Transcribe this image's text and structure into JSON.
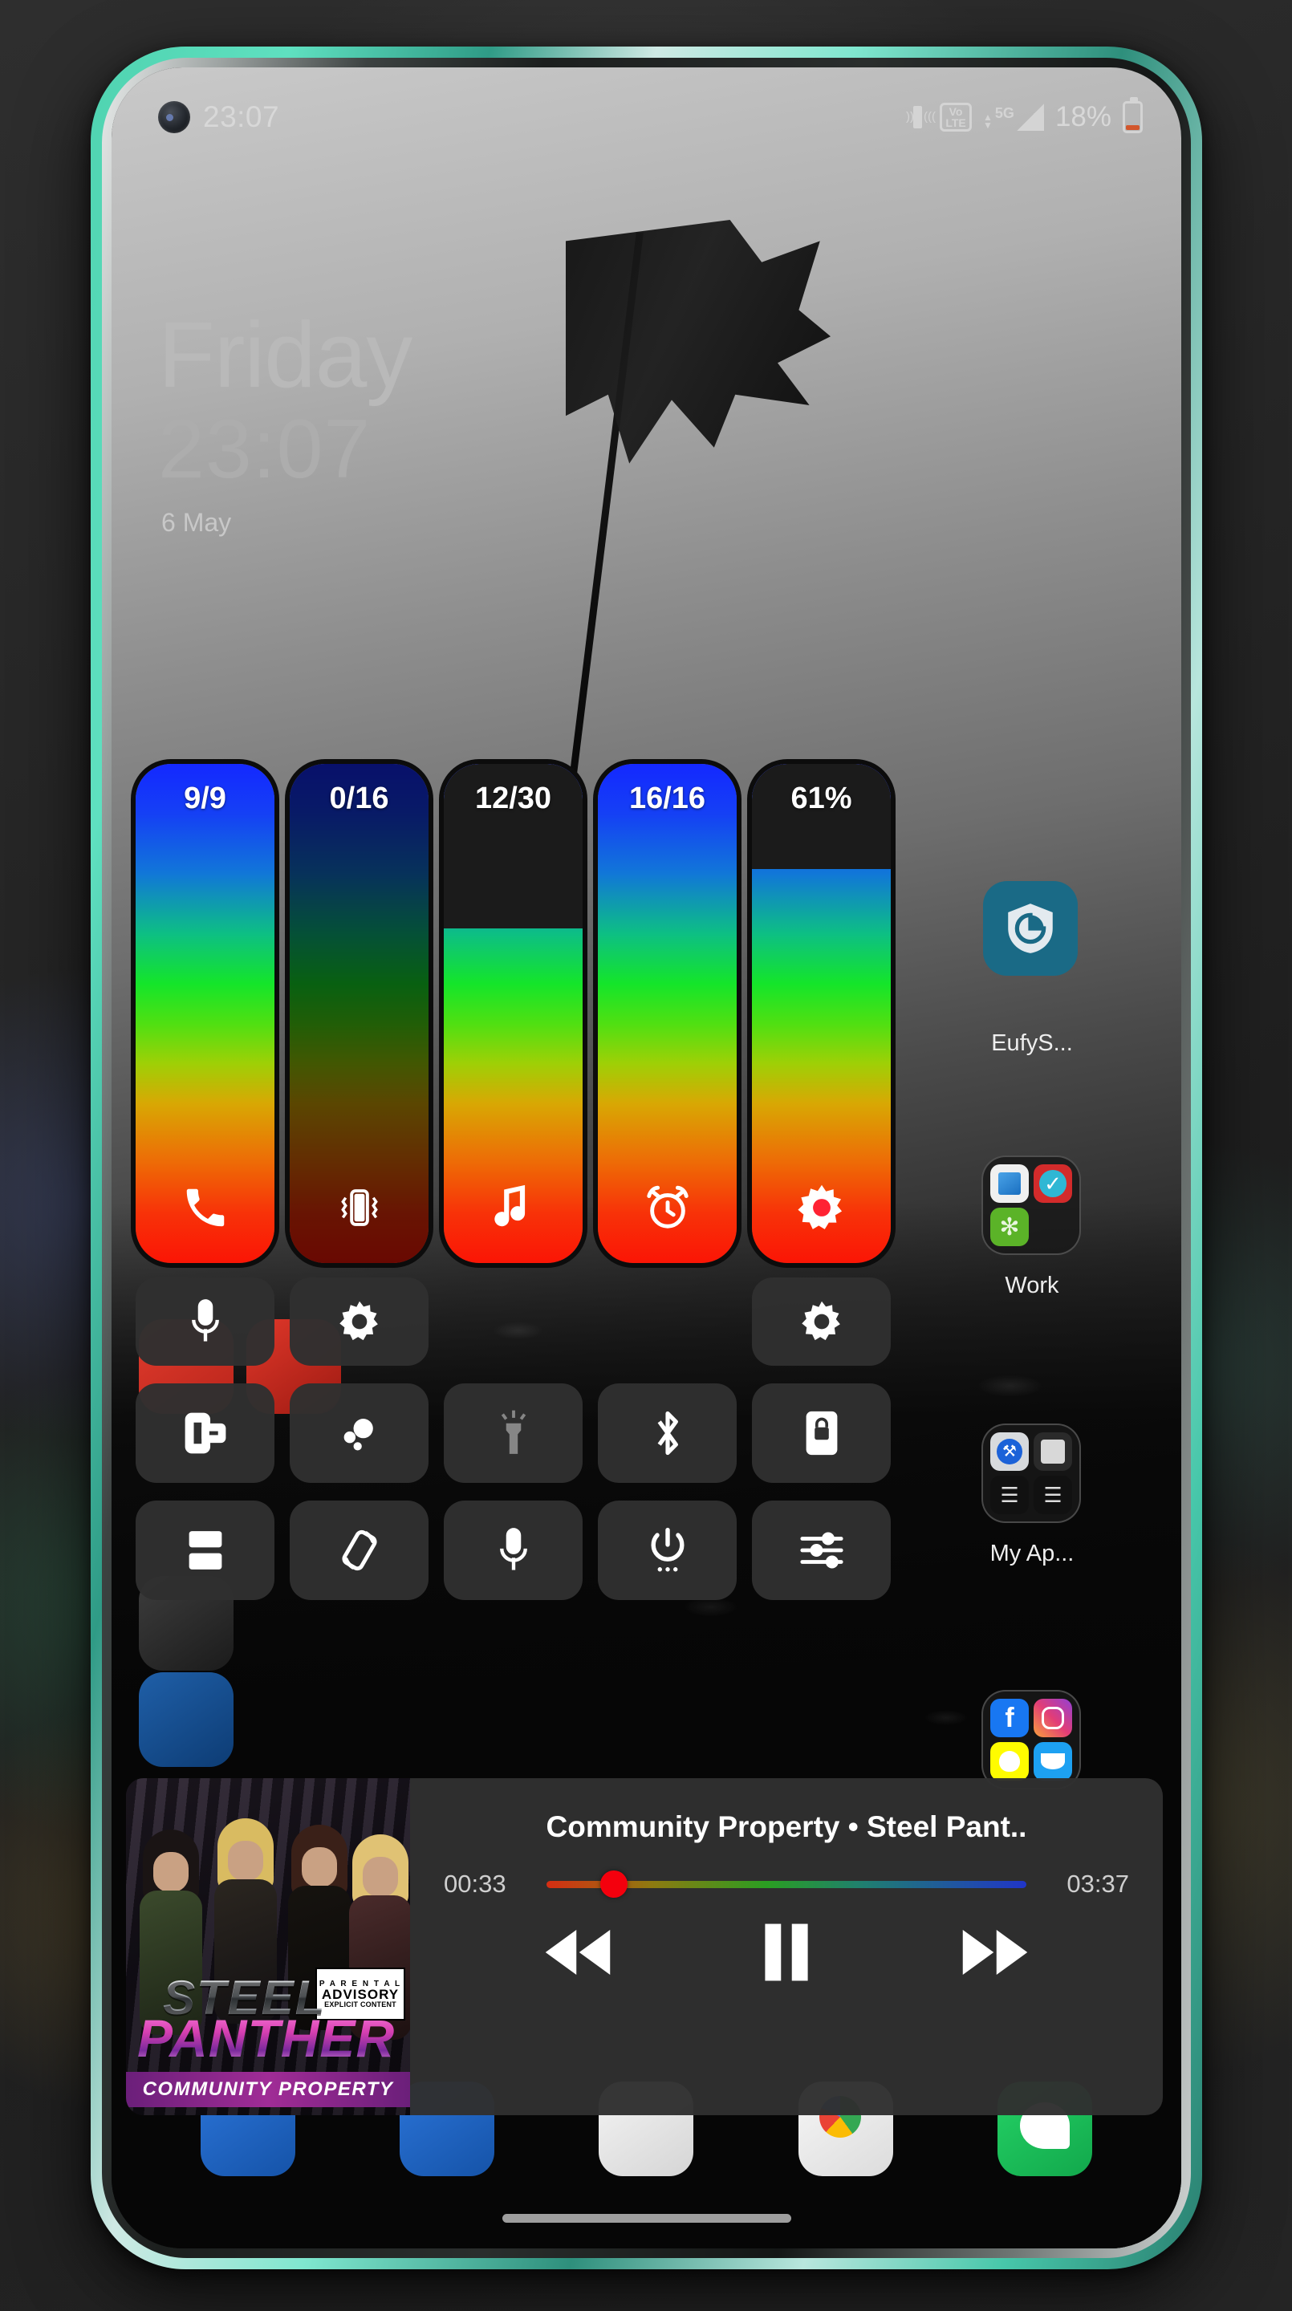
{
  "device": {
    "frame_color": "#4fd3b0",
    "earpiece": "speaker-grille"
  },
  "status_bar": {
    "clock": "23:07",
    "battery_percent": "18%",
    "network_type": "5G",
    "volte_line1": "Vo",
    "volte_line2": "LTE",
    "icons": [
      "camera-punch-hole",
      "vibrate-icon",
      "volte-icon",
      "data-arrows-icon",
      "signal-bars-icon",
      "battery-icon"
    ]
  },
  "lockscreen_widget": {
    "day": "Friday",
    "time": "23:07",
    "date": "6 May"
  },
  "volume_panel": {
    "sliders": [
      {
        "name": "ring",
        "value_label": "9/9",
        "icon": "phone-icon",
        "level_pct": 100,
        "dim": false
      },
      {
        "name": "notification",
        "value_label": "0/16",
        "icon": "vibrate-icon",
        "level_pct": 100,
        "dim": true
      },
      {
        "name": "media",
        "value_label": "12/30",
        "icon": "music-note-icon",
        "level_pct": 67,
        "dim": false
      },
      {
        "name": "alarm",
        "value_label": "16/16",
        "icon": "alarm-clock-icon",
        "level_pct": 100,
        "dim": false
      },
      {
        "name": "brightness",
        "value_label": "61%",
        "icon": "brightness-icon",
        "level_pct": 79,
        "dim": false
      }
    ],
    "row1": [
      {
        "name": "microphone-volume",
        "icon": "microphone-icon",
        "enabled": true
      },
      {
        "name": "sound-settings",
        "icon": "gear-icon",
        "enabled": true
      },
      {
        "name": "empty-slot-1",
        "icon": "",
        "enabled": true
      },
      {
        "name": "empty-slot-2",
        "icon": "",
        "enabled": true
      },
      {
        "name": "display-settings",
        "icon": "gear-icon",
        "enabled": true
      }
    ],
    "row2": [
      {
        "name": "cast-screen",
        "icon": "screen-cast-icon",
        "enabled": true
      },
      {
        "name": "notification-dots",
        "icon": "bubbles-icon",
        "enabled": true
      },
      {
        "name": "flashlight",
        "icon": "flashlight-icon",
        "enabled": false
      },
      {
        "name": "bluetooth",
        "icon": "bluetooth-icon",
        "enabled": true
      },
      {
        "name": "screen-lock",
        "icon": "phone-lock-icon",
        "enabled": true
      }
    ],
    "row3": [
      {
        "name": "split-screen",
        "icon": "split-screen-icon",
        "enabled": true
      },
      {
        "name": "auto-rotate",
        "icon": "rotate-icon",
        "enabled": true
      },
      {
        "name": "voice-record",
        "icon": "microphone-icon",
        "enabled": true
      },
      {
        "name": "power-menu",
        "icon": "power-icon",
        "enabled": true
      },
      {
        "name": "quick-settings",
        "icon": "sliders-icon",
        "enabled": true
      }
    ]
  },
  "media_player": {
    "track_line": "Community Property  •  Steel Pant..",
    "current_time": "00:33",
    "total_time": "03:37",
    "progress_pct": 15,
    "album_art": {
      "artist": "PANTHER",
      "artist_top": "STEEL",
      "album": "COMMUNITY PROPERTY",
      "advisory_1": "P A R E N T A L",
      "advisory_2": "ADVISORY",
      "advisory_3": "EXPLICIT CONTENT"
    },
    "controls": [
      {
        "name": "previous-track-button",
        "icon": "rewind-icon"
      },
      {
        "name": "pause-button",
        "icon": "pause-icon"
      },
      {
        "name": "next-track-button",
        "icon": "fast-forward-icon"
      }
    ]
  },
  "home_screen": {
    "apps": [
      {
        "name": "eufy-security",
        "label": "EufyS...",
        "icon": "shield-icon",
        "color": "#1a6a86"
      }
    ],
    "folders": [
      {
        "name": "work-folder",
        "label": "Work"
      },
      {
        "name": "my-apps-folder",
        "label": "My Ap..."
      },
      {
        "name": "social-folder",
        "label": ""
      }
    ]
  },
  "colors": {
    "accent_green": "#4fd3b0",
    "slider_top": "#1428ff",
    "slider_mid": "#14e52a",
    "slider_bottom": "#fb1505",
    "panel_bg": "#303030",
    "thumb_red": "#f4000d"
  }
}
